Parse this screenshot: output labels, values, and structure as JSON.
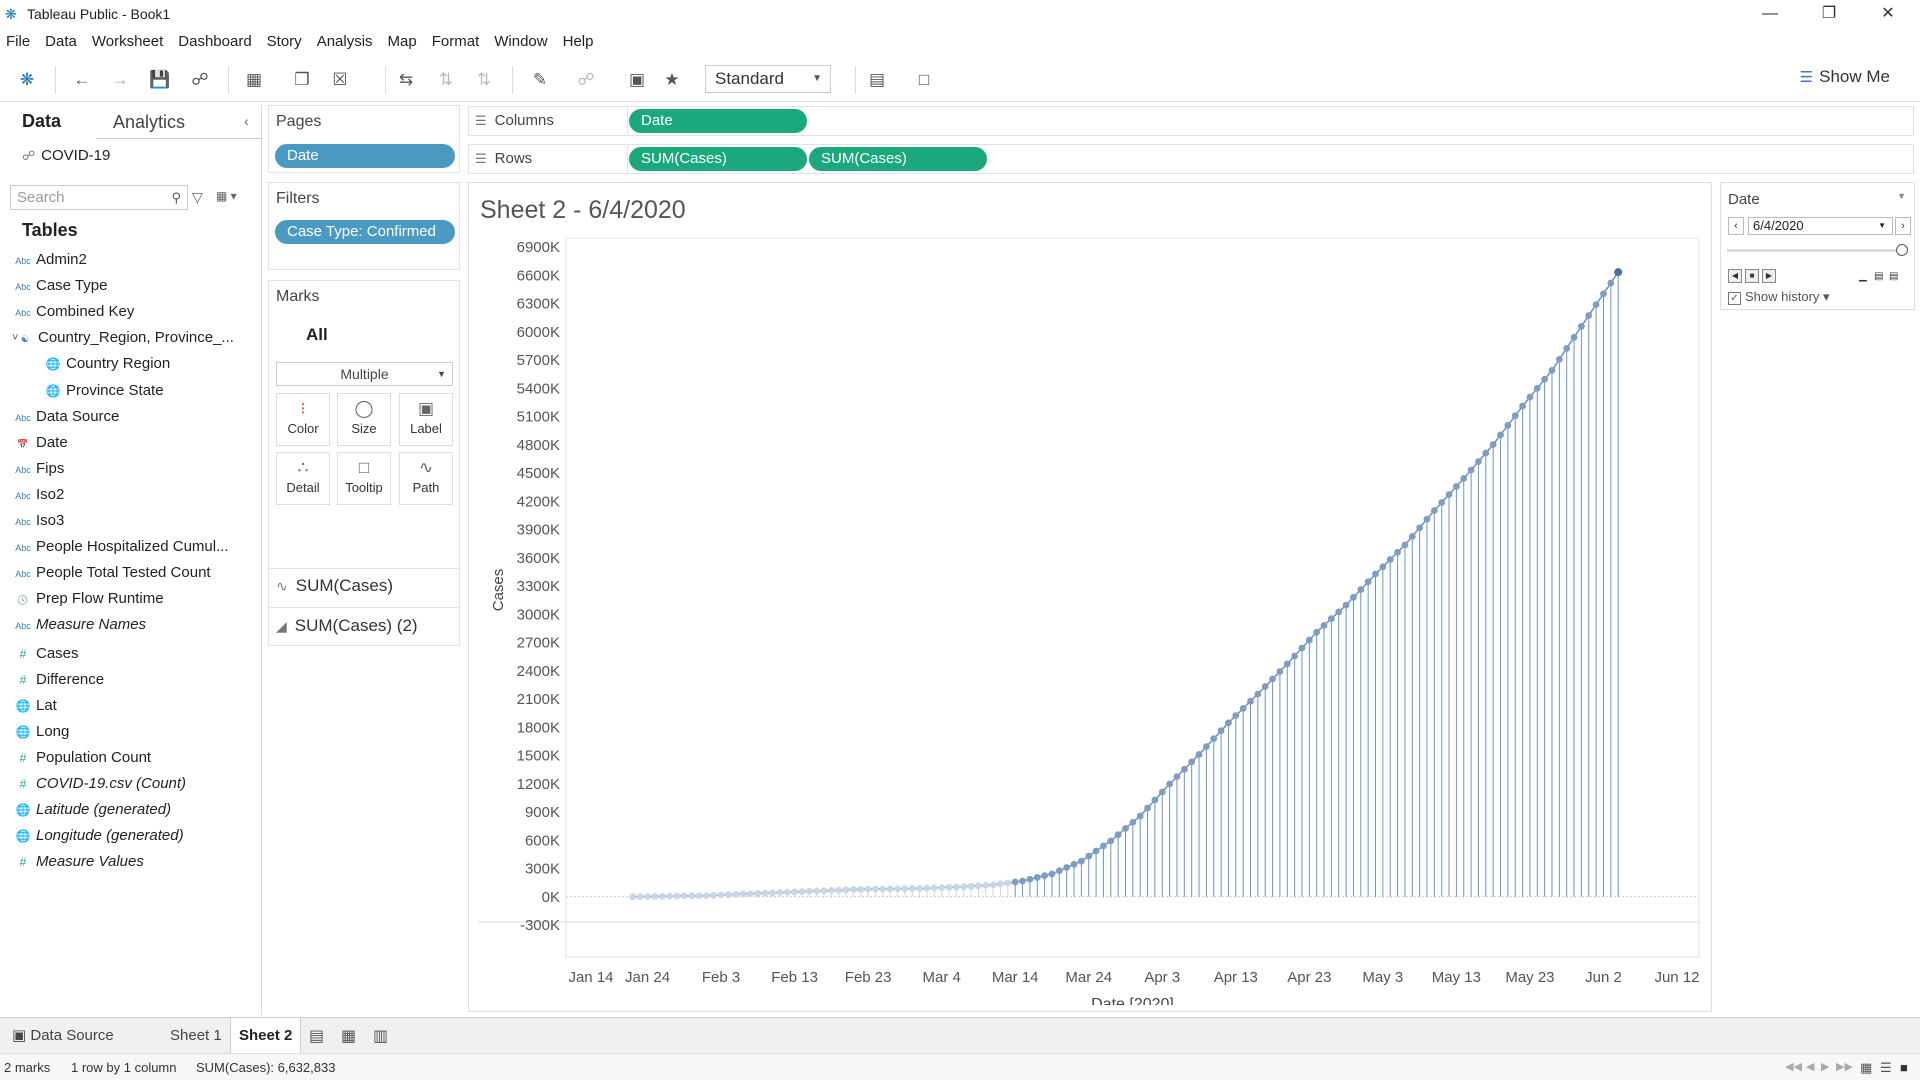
{
  "window": {
    "title": "Tableau Public - Book1",
    "minimize": "—",
    "restore": "❐",
    "close": "✕"
  },
  "menu": [
    "File",
    "Data",
    "Worksheet",
    "Dashboard",
    "Story",
    "Analysis",
    "Map",
    "Format",
    "Window",
    "Help"
  ],
  "toolbar": {
    "fit": "Standard",
    "show_me": "Show Me"
  },
  "data_pane": {
    "tab_data": "Data",
    "tab_analytics": "Analytics",
    "datasource": "COVID-19",
    "search_placeholder": "Search",
    "tables_heading": "Tables",
    "fields": [
      {
        "label": "Admin2",
        "type": "Abc"
      },
      {
        "label": "Case Type",
        "type": "Abc"
      },
      {
        "label": "Combined Key",
        "type": "Abc"
      },
      {
        "label": "Country_Region, Province_...",
        "type": "hier"
      },
      {
        "label": "Country Region",
        "type": "geo",
        "indent": true
      },
      {
        "label": "Province State",
        "type": "geo",
        "indent": true
      },
      {
        "label": "Data Source",
        "type": "Abc"
      },
      {
        "label": "Date",
        "type": "date"
      },
      {
        "label": "Fips",
        "type": "Abc"
      },
      {
        "label": "Iso2",
        "type": "Abc"
      },
      {
        "label": "Iso3",
        "type": "Abc"
      },
      {
        "label": "People Hospitalized Cumul...",
        "type": "Abc"
      },
      {
        "label": "People Total Tested Count",
        "type": "Abc"
      },
      {
        "label": "Prep Flow Runtime",
        "type": "datetime"
      },
      {
        "label": "Measure Names",
        "type": "Abc",
        "italic": true
      },
      {
        "label": "Cases",
        "type": "measure"
      },
      {
        "label": "Difference",
        "type": "measure"
      },
      {
        "label": "Lat",
        "type": "geo"
      },
      {
        "label": "Long",
        "type": "geo"
      },
      {
        "label": "Population Count",
        "type": "measure"
      },
      {
        "label": "COVID-19.csv (Count)",
        "type": "measure",
        "italic": true
      },
      {
        "label": "Latitude (generated)",
        "type": "geo",
        "italic": true
      },
      {
        "label": "Longitude (generated)",
        "type": "geo",
        "italic": true
      },
      {
        "label": "Measure Values",
        "type": "measure",
        "italic": true
      }
    ]
  },
  "pages": {
    "heading": "Pages",
    "pill": "Date"
  },
  "filters": {
    "heading": "Filters",
    "pill": "Case Type: Confirmed"
  },
  "marks": {
    "heading": "Marks",
    "all": "All",
    "type": "Multiple",
    "buttons": [
      "Color",
      "Size",
      "Label",
      "Detail",
      "Tooltip",
      "Path"
    ],
    "layers": [
      "SUM(Cases)",
      "SUM(Cases) (2)"
    ]
  },
  "shelves": {
    "columns_label": "Columns",
    "columns_pill": "Date",
    "rows_label": "Rows",
    "rows_pills": [
      "SUM(Cases)",
      "SUM(Cases)"
    ]
  },
  "sheet": {
    "title": "Sheet 2 - 6/4/2020"
  },
  "date_control": {
    "heading": "Date",
    "value": "6/4/2020",
    "show_history": "Show history"
  },
  "chart_data": {
    "type": "line",
    "marks_combination": "line with vertical drop lines (dual axis)",
    "xlabel": "Date [2020]",
    "ylabel": "Cases",
    "x_ticks": [
      "Jan 14",
      "Jan 24",
      "Feb 3",
      "Feb 13",
      "Feb 23",
      "Mar 4",
      "Mar 14",
      "Mar 24",
      "Apr 3",
      "Apr 13",
      "Apr 23",
      "May 3",
      "May 13",
      "May 23",
      "Jun 2",
      "Jun 12"
    ],
    "y_ticks": [
      "-300K",
      "0K",
      "300K",
      "600K",
      "900K",
      "1200K",
      "1500K",
      "1800K",
      "2100K",
      "2400K",
      "2700K",
      "3000K",
      "3300K",
      "3600K",
      "3900K",
      "4200K",
      "4500K",
      "4800K",
      "5100K",
      "5400K",
      "5700K",
      "6000K",
      "6300K",
      "6600K",
      "6900K"
    ],
    "ylim": [
      -300000,
      6900000
    ],
    "xlim": [
      "2020-01-14",
      "2020-06-12"
    ],
    "color": "#6a8fb8",
    "series": [
      {
        "name": "SUM(Cases)",
        "points": [
          {
            "x": "2020-01-22",
            "y": 555
          },
          {
            "x": "2020-02-01",
            "y": 12038
          },
          {
            "x": "2020-02-11",
            "y": 45171
          },
          {
            "x": "2020-02-21",
            "y": 76841
          },
          {
            "x": "2020-03-01",
            "y": 88369
          },
          {
            "x": "2020-03-07",
            "y": 105824
          },
          {
            "x": "2020-03-11",
            "y": 126214
          },
          {
            "x": "2020-03-15",
            "y": 167454
          },
          {
            "x": "2020-03-19",
            "y": 242488
          },
          {
            "x": "2020-03-23",
            "y": 378235
          },
          {
            "x": "2020-03-27",
            "y": 593291
          },
          {
            "x": "2020-03-31",
            "y": 857487
          },
          {
            "x": "2020-04-04",
            "y": 1197405
          },
          {
            "x": "2020-04-08",
            "y": 1511104
          },
          {
            "x": "2020-04-12",
            "y": 1846680
          },
          {
            "x": "2020-04-16",
            "y": 2152647
          },
          {
            "x": "2020-04-20",
            "y": 2472259
          },
          {
            "x": "2020-04-24",
            "y": 2810325
          },
          {
            "x": "2020-04-28",
            "y": 3097229
          },
          {
            "x": "2020-05-02",
            "y": 3427343
          },
          {
            "x": "2020-05-06",
            "y": 3735571
          },
          {
            "x": "2020-05-10",
            "y": 4101699
          },
          {
            "x": "2020-05-14",
            "y": 4442163
          },
          {
            "x": "2020-05-18",
            "y": 4801943
          },
          {
            "x": "2020-05-22",
            "y": 5210817
          },
          {
            "x": "2020-05-26",
            "y": 5589626
          },
          {
            "x": "2020-05-30",
            "y": 6057853
          },
          {
            "x": "2020-06-04",
            "y": 6632833
          }
        ]
      }
    ]
  },
  "bottom_tabs": {
    "datasource": "Data Source",
    "sheet1": "Sheet 1",
    "sheet2": "Sheet 2"
  },
  "status": {
    "marks": "2 marks",
    "rows": "1 row by 1 column",
    "sum": "SUM(Cases): 6,632,833"
  }
}
